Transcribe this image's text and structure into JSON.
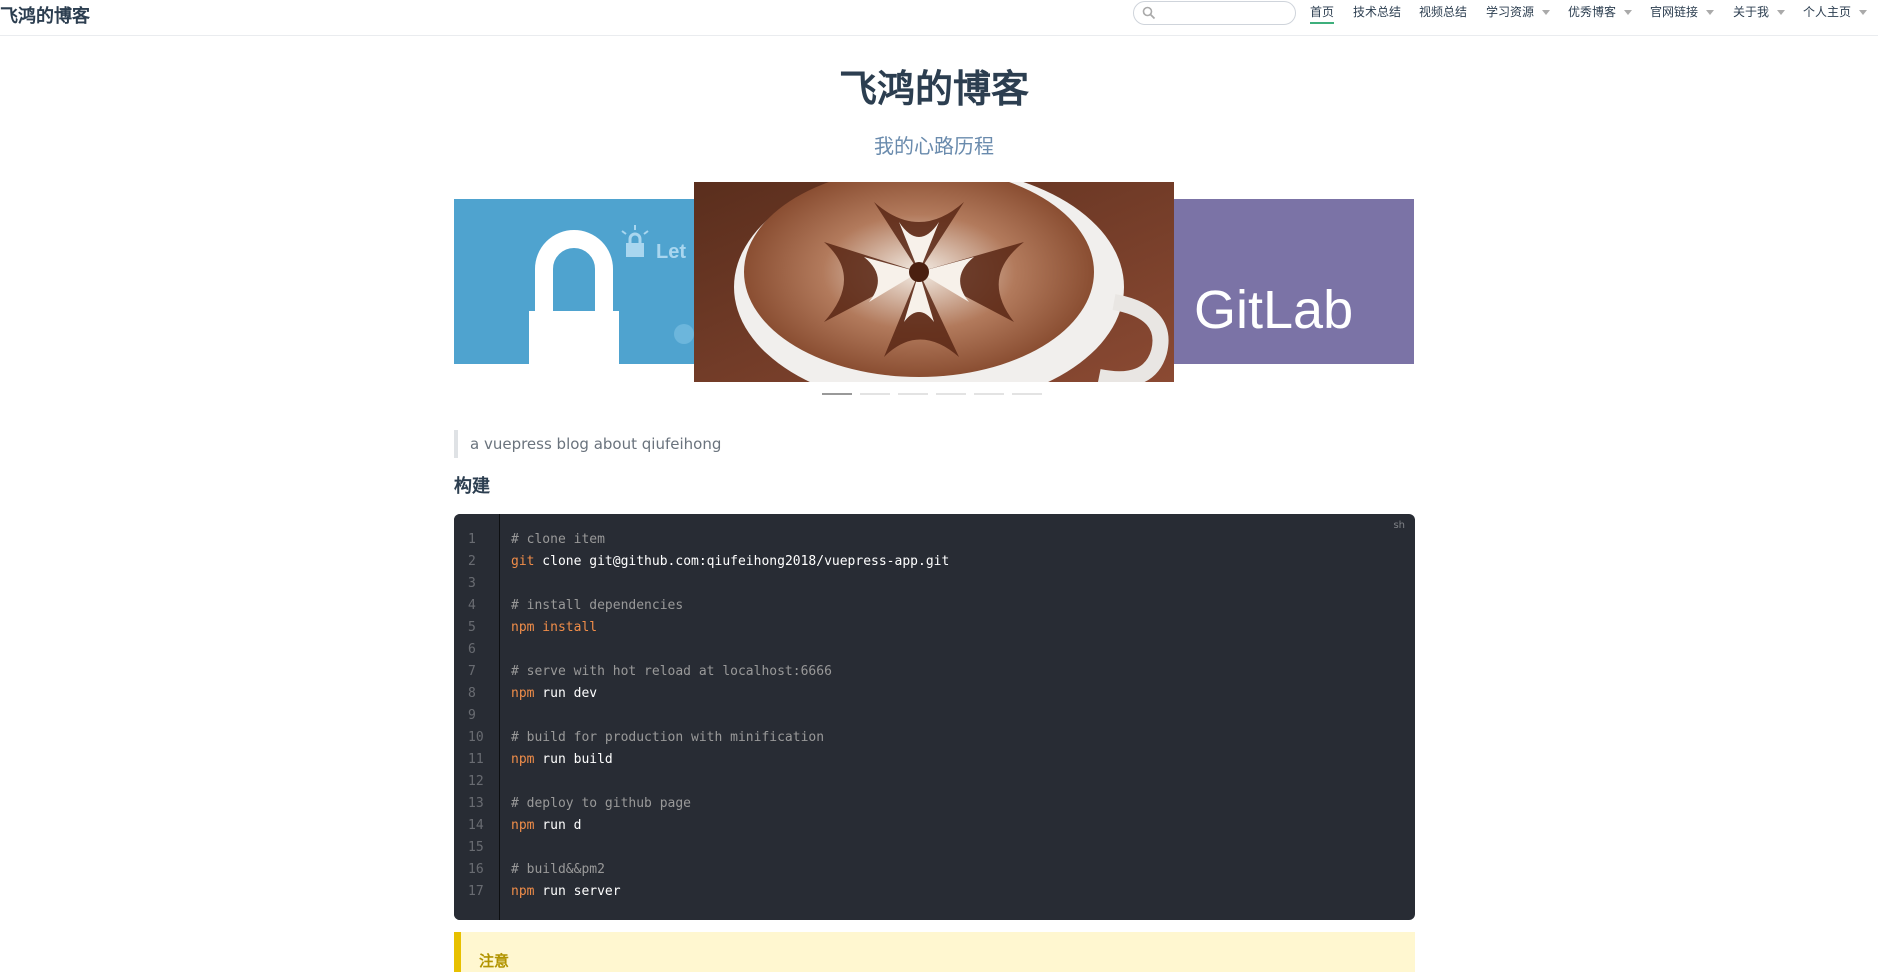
{
  "navbar": {
    "site_name": "飞鸿的博客",
    "search_placeholder": "",
    "items": [
      {
        "label": "首页",
        "active": true,
        "dropdown": false
      },
      {
        "label": "技术总结",
        "active": false,
        "dropdown": false
      },
      {
        "label": "视频总结",
        "active": false,
        "dropdown": false
      },
      {
        "label": "学习资源",
        "active": false,
        "dropdown": true
      },
      {
        "label": "优秀博客",
        "active": false,
        "dropdown": true
      },
      {
        "label": "官网链接",
        "active": false,
        "dropdown": true
      },
      {
        "label": "关于我",
        "active": false,
        "dropdown": true
      },
      {
        "label": "个人主页",
        "active": false,
        "dropdown": true
      }
    ],
    "accent_color": "#3eaf7c"
  },
  "hero": {
    "title": "飞鸿的博客",
    "subtitle": "我的心路历程"
  },
  "carousel": {
    "slides": [
      {
        "name": "letsencrypt-lock",
        "caption": "Let"
      },
      {
        "name": "latte-art-coffee",
        "caption": ""
      },
      {
        "name": "gitlab-logo",
        "caption": "GitLab"
      }
    ],
    "indicator_count": 6,
    "active_index": 0
  },
  "content": {
    "blockquote": "a vuepress blog about qiufeihong",
    "heading": "构建",
    "code": {
      "language": "sh",
      "lines": [
        {
          "n": "1",
          "tokens": [
            {
              "t": "comment",
              "v": "# clone item"
            }
          ]
        },
        {
          "n": "2",
          "tokens": [
            {
              "t": "cmd",
              "v": "git"
            },
            {
              "t": "plain",
              "v": " clone git@github.com:qiufeihong2018/vuepress-app.git"
            }
          ]
        },
        {
          "n": "3",
          "tokens": []
        },
        {
          "n": "4",
          "tokens": [
            {
              "t": "comment",
              "v": "# install dependencies"
            }
          ]
        },
        {
          "n": "5",
          "tokens": [
            {
              "t": "cmd",
              "v": "npm install"
            }
          ]
        },
        {
          "n": "6",
          "tokens": []
        },
        {
          "n": "7",
          "tokens": [
            {
              "t": "comment",
              "v": "# serve with hot reload at localhost:6666"
            }
          ]
        },
        {
          "n": "8",
          "tokens": [
            {
              "t": "cmd",
              "v": "npm"
            },
            {
              "t": "plain",
              "v": " run dev"
            }
          ]
        },
        {
          "n": "9",
          "tokens": []
        },
        {
          "n": "10",
          "tokens": [
            {
              "t": "comment",
              "v": "# build for production with minification"
            }
          ]
        },
        {
          "n": "11",
          "tokens": [
            {
              "t": "cmd",
              "v": "npm"
            },
            {
              "t": "plain",
              "v": " run build"
            }
          ]
        },
        {
          "n": "12",
          "tokens": []
        },
        {
          "n": "13",
          "tokens": [
            {
              "t": "comment",
              "v": "# deploy to github page"
            }
          ]
        },
        {
          "n": "14",
          "tokens": [
            {
              "t": "cmd",
              "v": "npm"
            },
            {
              "t": "plain",
              "v": " run d"
            }
          ]
        },
        {
          "n": "15",
          "tokens": []
        },
        {
          "n": "16",
          "tokens": [
            {
              "t": "comment",
              "v": "# build&&pm2"
            }
          ]
        },
        {
          "n": "17",
          "tokens": [
            {
              "t": "cmd",
              "v": "npm"
            },
            {
              "t": "plain",
              "v": " run server"
            }
          ]
        }
      ]
    },
    "tip_title": "注意"
  }
}
